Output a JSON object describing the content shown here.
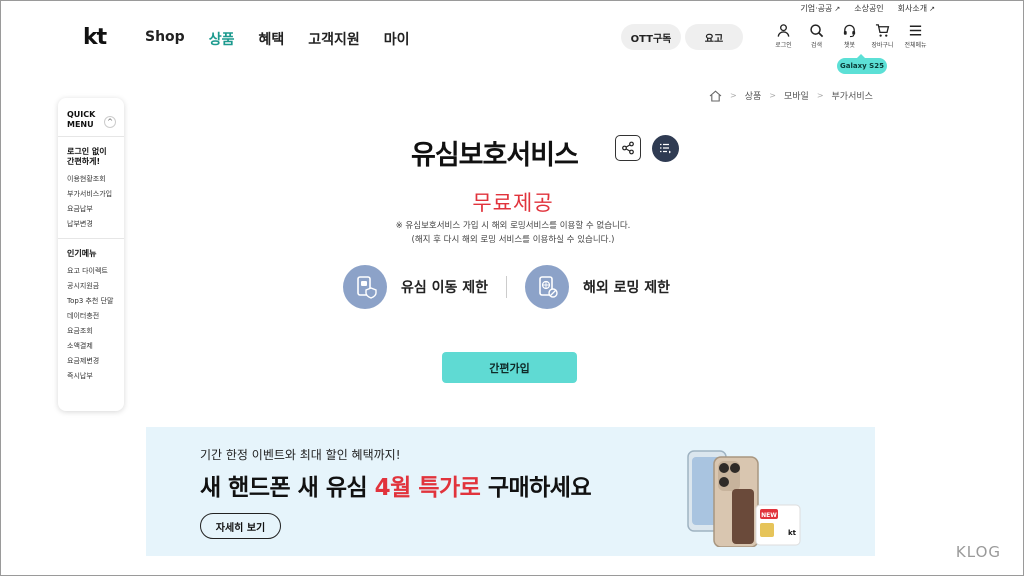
{
  "utility": {
    "business": "기업·공공",
    "dealer": "소상공인",
    "company": "회사소개"
  },
  "header": {
    "logo": "kt",
    "nav": [
      "Shop",
      "상품",
      "혜택",
      "고객지원",
      "마이"
    ],
    "ott_label": "OTT구독",
    "fee_label": "요고",
    "icons": [
      {
        "icon": "user-icon",
        "label": "로그인"
      },
      {
        "icon": "search-icon",
        "label": "검색"
      },
      {
        "icon": "headset-icon",
        "label": "챗봇"
      },
      {
        "icon": "cart-icon",
        "label": "장바구니"
      },
      {
        "icon": "menu-icon",
        "label": "전체메뉴"
      }
    ],
    "galaxy_badge": "Galaxy S25"
  },
  "breadcrumb": [
    "상품",
    "모바일",
    "부가서비스"
  ],
  "quick_menu": {
    "title_line1": "QUICK",
    "title_line2": "MENU",
    "section1_line1": "로그인 없이",
    "section1_line2": "간편하게!",
    "section1_items": [
      "이용현황조회",
      "부가서비스가입",
      "요금납부",
      "납부변경"
    ],
    "section2_title": "인기메뉴",
    "section2_items": [
      "요고 다이렉트",
      "공시지원금",
      "Top3 추천 단말",
      "데이터충전",
      "요금조회",
      "소액결제",
      "요금제변경",
      "즉시납부"
    ]
  },
  "main": {
    "title": "유심보호서비스",
    "price": "무료제공",
    "note1": "※ 유심보호서비스 가입 시 해외 로밍서비스를 이용할 수 없습니다.",
    "note2": "(해지 후 다시 해외 로밍 서비스를 이용하실 수 있습니다.)",
    "feature1": "유심 이동 제한",
    "feature2": "해외 로밍 제한",
    "cta": "간편가입"
  },
  "banner": {
    "subtitle": "기간 한정 이벤트와 최대 할인 혜택까지!",
    "headline_a": "새 핸드폰 새 유심 ",
    "headline_red": "4월 특가로",
    "headline_b": " 구매하세요",
    "button": "자세히 보기",
    "sim_new": "NEW",
    "sim_brand": "kt"
  },
  "watermark": "KLOG",
  "colors": {
    "accent": "#5fdad3",
    "active_nav": "#1c9a8e",
    "price_red": "#e1333c",
    "banner_bg": "#e6f4fb",
    "icon_circle": "#8ca2c8"
  }
}
